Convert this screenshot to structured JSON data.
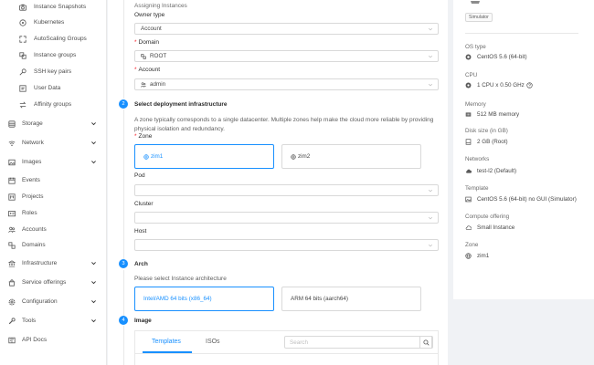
{
  "sidebar": {
    "items": [
      {
        "label": "Instance Snapshots",
        "icon": "camera-icon",
        "sub": true
      },
      {
        "label": "Kubernetes",
        "icon": "kubernetes-icon",
        "sub": true
      },
      {
        "label": "AutoScaling Groups",
        "icon": "expand-icon",
        "sub": true
      },
      {
        "label": "Instance groups",
        "icon": "group-icon",
        "sub": true
      },
      {
        "label": "SSH key pairs",
        "icon": "key-icon",
        "sub": true
      },
      {
        "label": "User Data",
        "icon": "form-icon",
        "sub": true
      },
      {
        "label": "Affinity groups",
        "icon": "swap-icon",
        "sub": true
      },
      {
        "label": "Storage",
        "icon": "database-icon",
        "chevron": true
      },
      {
        "label": "Network",
        "icon": "wifi-icon",
        "chevron": true
      },
      {
        "label": "Images",
        "icon": "picture-icon",
        "chevron": true
      },
      {
        "label": "Events",
        "icon": "schedule-icon"
      },
      {
        "label": "Projects",
        "icon": "project-icon"
      },
      {
        "label": "Roles",
        "icon": "idcard-icon"
      },
      {
        "label": "Accounts",
        "icon": "team-icon"
      },
      {
        "label": "Domains",
        "icon": "block-icon"
      },
      {
        "label": "Infrastructure",
        "icon": "bank-icon",
        "chevron": true
      },
      {
        "label": "Service offerings",
        "icon": "shopping-icon",
        "chevron": true
      },
      {
        "label": "Configuration",
        "icon": "setting-icon",
        "chevron": true
      },
      {
        "label": "Tools",
        "icon": "tool-icon",
        "chevron": true
      },
      {
        "label": "API Docs",
        "icon": "read-icon"
      }
    ]
  },
  "form": {
    "assigning_title": "Assigning Instances",
    "owner_type_label": "Owner type",
    "owner_type_value": "Account",
    "domain_label": "Domain",
    "domain_value": "ROOT",
    "account_label": "Account",
    "account_value": "admin",
    "step2": {
      "number": "2",
      "title": "Select deployment infrastructure",
      "desc": "A zone typically corresponds to a single datacenter. Multiple zones help make the cloud more reliable by providing physical isolation and redundancy.",
      "zone_label": "Zone",
      "zones": [
        "zim1",
        "zim2"
      ],
      "pod_label": "Pod",
      "cluster_label": "Cluster",
      "host_label": "Host"
    },
    "step3": {
      "number": "3",
      "title": "Arch",
      "desc": "Please select Instance architecture",
      "options": [
        "Intel/AMD 64 bits (x86_64)",
        "ARM 64 bits (aarch64)"
      ]
    },
    "step4": {
      "number": "4",
      "title": "Image",
      "tabs": [
        "Templates",
        "ISOs"
      ],
      "search_placeholder": "Search"
    }
  },
  "summary": {
    "tag": "Simulator",
    "os_type_label": "OS type",
    "os_type_value": "CentOS 5.6 (64-bit)",
    "cpu_label": "CPU",
    "cpu_value": "1 CPU x 0.50 GHz",
    "memory_label": "Memory",
    "memory_value": "512 MB memory",
    "disk_label": "Disk size (in GB)",
    "disk_value": "2 GB (Root)",
    "networks_label": "Networks",
    "networks_value": "test-l2 (Default)",
    "template_label": "Template",
    "template_value": "CentOS 5.6 (64-bit) no GUI (Simulator)",
    "compute_label": "Compute offering",
    "compute_value": "Small Instance",
    "zone_label": "Zone",
    "zone_value": "zim1"
  },
  "colors": {
    "accent": "#1890ff",
    "required": "#f5222d",
    "background": "#f0f2f5"
  }
}
